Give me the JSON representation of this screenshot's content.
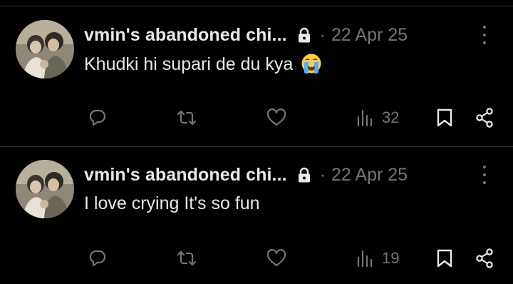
{
  "tweets": [
    {
      "display_name": "vmin's abandoned chi...",
      "separator": "·",
      "date": "22 Apr 25",
      "text": "Khudki hi supari de du kya",
      "emoji": "loudly-crying-face",
      "views": "32"
    },
    {
      "display_name": "vmin's abandoned chi...",
      "separator": "·",
      "date": "22 Apr 25",
      "text": "I love crying It's so fun",
      "views": "19"
    }
  ],
  "colors": {
    "background": "#000000",
    "primary_text": "#e7e9ea",
    "secondary_text": "#71767b",
    "divider": "#2f3336"
  },
  "icons": [
    "lock-icon",
    "more-icon",
    "reply-icon",
    "retweet-icon",
    "like-icon",
    "views-icon",
    "bookmark-icon",
    "share-icon"
  ]
}
